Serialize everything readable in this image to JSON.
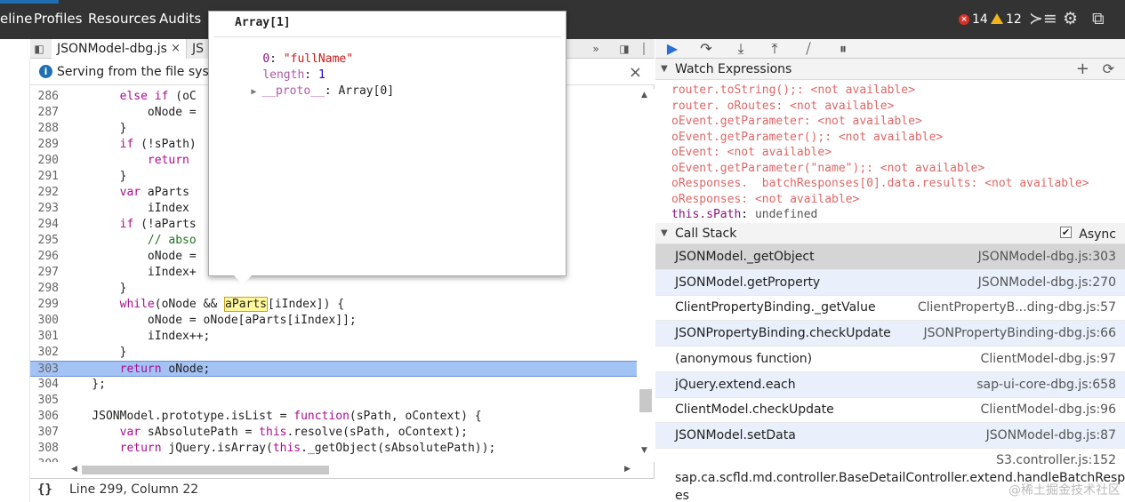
{
  "topnav": {
    "tabs": [
      "eline",
      "Profiles",
      "Resources",
      "Audits"
    ],
    "error_count": "14",
    "warning_count": "12",
    "colors": {
      "bg": "#333333",
      "accent": "#1f6fb2"
    }
  },
  "source": {
    "tabs": [
      {
        "label": "JSONModel-dbg.js",
        "close": "×",
        "active": true
      },
      {
        "label": "JS",
        "active": false
      }
    ],
    "overflow_label": "»",
    "infobar": {
      "message": "Serving from the file syste",
      "close": "×"
    },
    "status": "Line 299, Column 22",
    "format_label": "{}"
  },
  "code_lines": [
    {
      "n": "286",
      "t": "        else if (oC"
    },
    {
      "n": "287",
      "t": "            oNode ="
    },
    {
      "n": "288",
      "t": "        }"
    },
    {
      "n": "289",
      "t": "        if (!sPath)"
    },
    {
      "n": "290",
      "t": "            return"
    },
    {
      "n": "291",
      "t": "        }"
    },
    {
      "n": "292",
      "t": "        var aParts"
    },
    {
      "n": "293",
      "t": "            iIndex"
    },
    {
      "n": "294",
      "t": "        if (!aParts"
    },
    {
      "n": "295",
      "t": "            // abso"
    },
    {
      "n": "296",
      "t": "            oNode ="
    },
    {
      "n": "297",
      "t": "            iIndex+"
    },
    {
      "n": "298",
      "t": "        }"
    },
    {
      "n": "299",
      "t": "        while(oNode && aParts[iIndex]) {"
    },
    {
      "n": "300",
      "t": "            oNode = oNode[aParts[iIndex]];"
    },
    {
      "n": "301",
      "t": "            iIndex++;"
    },
    {
      "n": "302",
      "t": "        }"
    },
    {
      "n": "303",
      "t": "        return oNode;"
    },
    {
      "n": "304",
      "t": "    };"
    },
    {
      "n": "305",
      "t": ""
    },
    {
      "n": "306",
      "t": "    JSONModel.prototype.isList = function(sPath, oContext) {"
    },
    {
      "n": "307",
      "t": "        var sAbsolutePath = this.resolve(sPath, oContext);"
    },
    {
      "n": "308",
      "t": "        return jQuery.isArray(this._getObject(sAbsolutePath));"
    },
    {
      "n": "309",
      "t": ""
    }
  ],
  "popover": {
    "title": "Array[1]",
    "index": "0",
    "value": "\"fullName\"",
    "length_key": "length",
    "length_val": "1",
    "proto_key": "__proto__",
    "proto_val": "Array[0]"
  },
  "watch": {
    "title": "Watch Expressions",
    "add": "+",
    "refresh": "⟳",
    "items": [
      {
        "name": "router.toString();",
        "value": "<not available>"
      },
      {
        "name": "router. oRoutes",
        "value": "<not available>"
      },
      {
        "name": "oEvent.getParameter",
        "value": "<not available>"
      },
      {
        "name": "oEvent.getParameter();",
        "value": "<not available>"
      },
      {
        "name": "oEvent",
        "value": "<not available>"
      },
      {
        "name": "oEvent.getParameter(\"name\");",
        "value": "<not available>"
      },
      {
        "name": "oResponses.  batchResponses[0].data.results",
        "value": "<not available>"
      },
      {
        "name": "oResponses",
        "value": "<not available>"
      },
      {
        "name": "this.sPath",
        "value": "undefined",
        "available": true
      }
    ]
  },
  "callstack": {
    "title": "Call Stack",
    "async_label": "Async",
    "frames": [
      {
        "fn": "JSONModel._getObject",
        "loc": "JSONModel-dbg.js:303",
        "selected": true
      },
      {
        "fn": "JSONModel.getProperty",
        "loc": "JSONModel-dbg.js:270",
        "alt": true
      },
      {
        "fn": "ClientPropertyBinding._getValue",
        "loc": "ClientPropertyB...ding-dbg.js:57"
      },
      {
        "fn": "JSONPropertyBinding.checkUpdate",
        "loc": "JSONPropertyBinding-dbg.js:66",
        "alt": true
      },
      {
        "fn": "(anonymous function)",
        "loc": "ClientModel-dbg.js:97"
      },
      {
        "fn": "jQuery.extend.each",
        "loc": "sap-ui-core-dbg.js:658",
        "alt": true
      },
      {
        "fn": "ClientModel.checkUpdate",
        "loc": "ClientModel-dbg.js:96"
      },
      {
        "fn": "JSONModel.setData",
        "loc": "JSONModel-dbg.js:87",
        "alt": true
      }
    ],
    "last_loc": "S3.controller.js:152",
    "last_fn": "sap.ca.scfld.md.controller.BaseDetailController.extend.handleBatchRespons",
    "last_fn_tail": "es"
  },
  "watermark": "@稀土掘金技术社区"
}
